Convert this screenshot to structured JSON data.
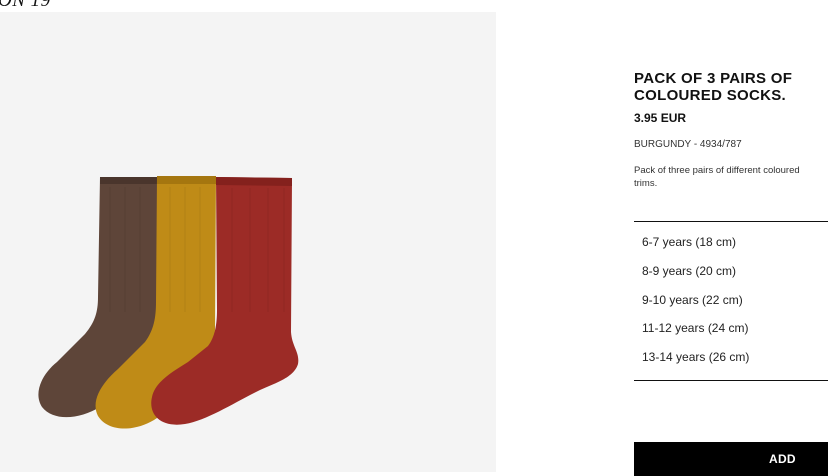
{
  "header": {
    "fragment_text": "ON 19"
  },
  "product": {
    "title": "PACK OF 3 PAIRS OF COLOURED SOCKS.",
    "price": "3.95 EUR",
    "color_reference": "BURGUNDY - 4934/787",
    "description_line1": "Pack of three pairs of different coloured",
    "description_line2": "trims.",
    "image_colors": {
      "brown": "#5e4539",
      "mustard": "#bf8b17",
      "burgundy": "#9c2b26",
      "background": "#f4f4f4"
    }
  },
  "sizes": {
    "options": [
      "6-7 years (18 cm)",
      "8-9 years (20 cm)",
      "9-10 years (22 cm)",
      "11-12 years (24 cm)",
      "13-14 years (26 cm)"
    ]
  },
  "actions": {
    "add_label": "ADD"
  }
}
